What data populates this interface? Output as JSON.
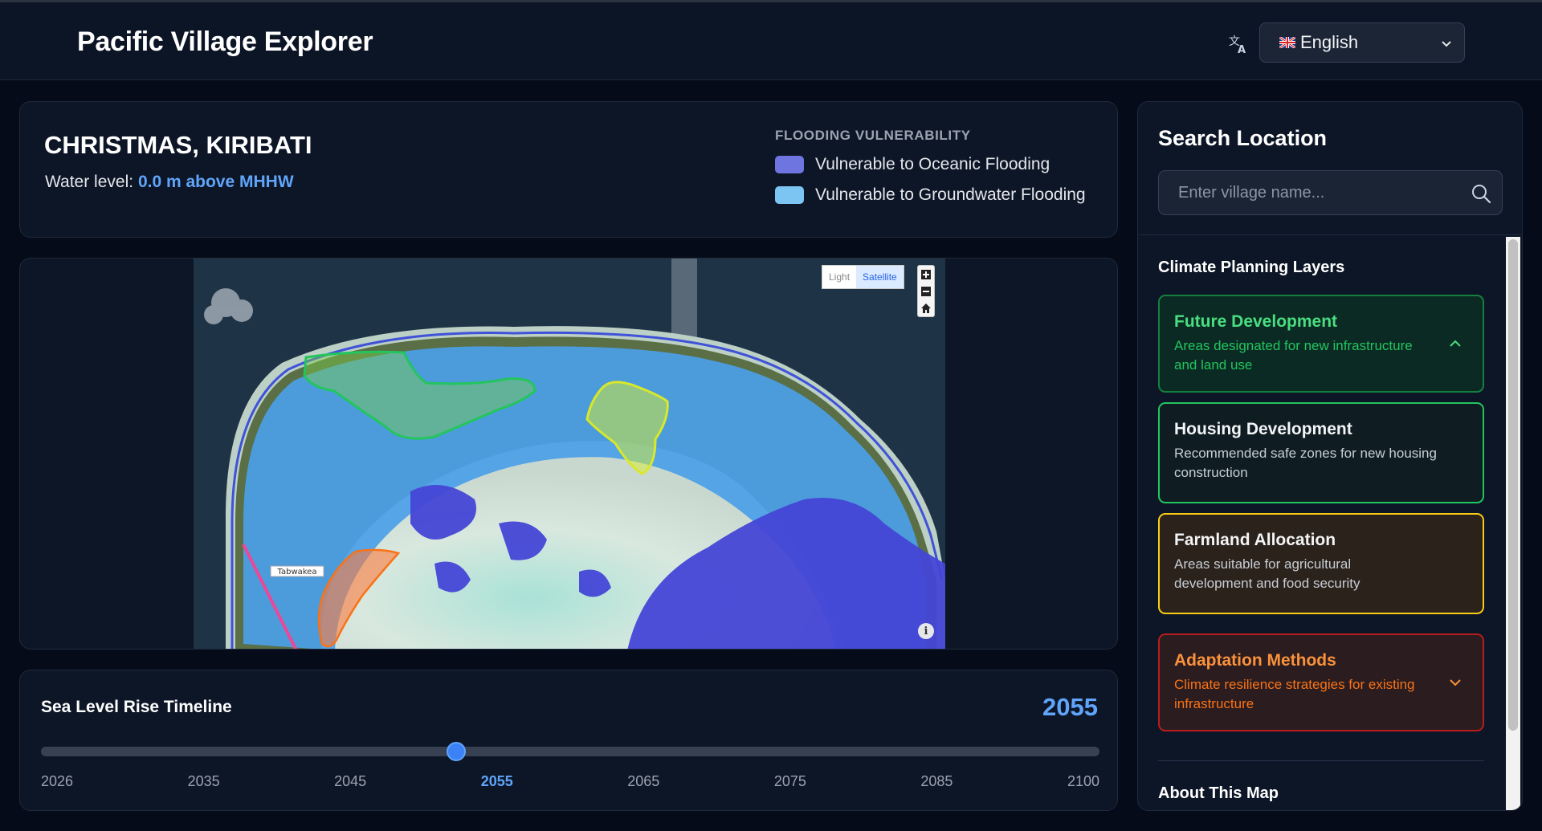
{
  "header": {
    "app_title": "Pacific Village Explorer",
    "language": {
      "selected": "English",
      "icon": "translate-icon",
      "flag": "uk-flag-icon"
    }
  },
  "location": {
    "name": "CHRISTMAS, KIRIBATI",
    "water_level_label": "Water level:",
    "water_level_value": "0.0 m above MHHW"
  },
  "legend": {
    "title": "FLOODING VULNERABILITY",
    "items": [
      {
        "label": "Vulnerable to Oceanic Flooding",
        "color": "#6f75e0"
      },
      {
        "label": "Vulnerable to Groundwater Flooding",
        "color": "#7cc4f2"
      }
    ]
  },
  "map": {
    "basemap_options": [
      "Light",
      "Satellite"
    ],
    "basemap_selected": "Satellite",
    "place_label": "Tabwakea",
    "controls": [
      "zoom-in-icon",
      "zoom-out-icon",
      "home-icon",
      "info-icon"
    ],
    "overlay_colors": {
      "future_development": "#22c55e",
      "housing": "#d9f02f",
      "farmland": "#fb7a3c",
      "adaptation": "#ec4899",
      "coastline": "#3f52d8"
    }
  },
  "timeline": {
    "title": "Sea Level Rise Timeline",
    "selected_year": "2055",
    "min_year": 2026,
    "max_year": 2100,
    "ticks": [
      "2026",
      "2035",
      "2045",
      "2055",
      "2065",
      "2075",
      "2085",
      "2100"
    ]
  },
  "sidebar": {
    "title": "Search Location",
    "search_placeholder": "Enter village name...",
    "layers_heading": "Climate Planning Layers",
    "layers": [
      {
        "title": "Future Development",
        "description": "Areas designated for new infrastructure and land use",
        "expanded": true
      },
      {
        "title": "Housing Development",
        "description": "Recommended safe zones for new housing construction"
      },
      {
        "title": "Farmland Allocation",
        "description": "Areas suitable for agricultural development and food security"
      },
      {
        "title": "Adaptation Methods",
        "description": "Climate resilience strategies for existing infrastructure",
        "expanded": false
      }
    ],
    "about_heading": "About This Map"
  }
}
